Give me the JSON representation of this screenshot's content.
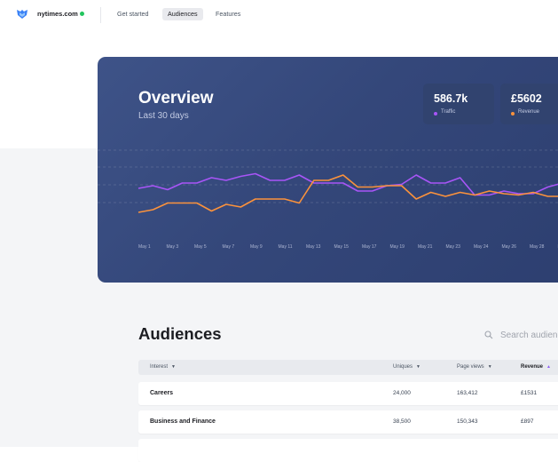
{
  "nav": {
    "site": "nytimes.com",
    "tabs": [
      "Get started",
      "Audiences",
      "Features"
    ],
    "active_tab": "Audiences"
  },
  "overview": {
    "title": "Overview",
    "subtitle": "Last 30 days",
    "stats": [
      {
        "value": "586.7k",
        "label": "Traffic",
        "color": "#a855f7"
      },
      {
        "value": "£5602",
        "label": "Revenue",
        "color": "#fb923c"
      }
    ]
  },
  "chart_data": {
    "type": "line",
    "x": [
      "May 1",
      "May 2",
      "May 3",
      "May 4",
      "May 5",
      "May 6",
      "May 7",
      "May 8",
      "May 9",
      "May 10",
      "May 11",
      "May 12",
      "May 13",
      "May 14",
      "May 15",
      "May 16",
      "May 17",
      "May 18",
      "May 19",
      "May 20",
      "May 21",
      "May 22",
      "May 23",
      "May 24",
      "May 25",
      "May 26",
      "May 27",
      "May 28",
      "May 29",
      "May 30"
    ],
    "tick_labels": [
      "May 1",
      "May 3",
      "May 5",
      "May 7",
      "May 9",
      "May 11",
      "May 13",
      "May 15",
      "May 17",
      "May 19",
      "May 21",
      "May 23",
      "May 24",
      "May 26",
      "May 28",
      "M"
    ],
    "series": [
      {
        "legend": "Traffic",
        "color": "#a855f7",
        "values": [
          38,
          40,
          37,
          42,
          42,
          46,
          44,
          47,
          49,
          44,
          44,
          48,
          42,
          42,
          42,
          36,
          36,
          40,
          41,
          48,
          42,
          42,
          46,
          33,
          33,
          36,
          34,
          34,
          39,
          42
        ]
      },
      {
        "legend": "Revenue",
        "color": "#fb923c",
        "values": [
          20,
          22,
          27,
          27,
          27,
          21,
          26,
          24,
          30,
          30,
          30,
          27,
          44,
          44,
          48,
          39,
          39,
          40,
          40,
          30,
          35,
          32,
          35,
          33,
          36,
          34,
          33,
          35,
          32,
          32
        ]
      }
    ],
    "ylim": [
      10,
      60
    ],
    "grid": true
  },
  "audiences": {
    "title": "Audiences",
    "search_placeholder": "Search audiences",
    "columns": [
      {
        "label": "Interest",
        "sort": "down",
        "sorted": false
      },
      {
        "label": "Uniques",
        "sort": "down",
        "sorted": false
      },
      {
        "label": "Page views",
        "sort": "down",
        "sorted": false
      },
      {
        "label": "Revenue",
        "sort": "up",
        "sorted": true
      }
    ],
    "rows": [
      [
        "Careers",
        "24,000",
        "163,412",
        "£1531"
      ],
      [
        "Business and Finance",
        "38,500",
        "150,343",
        "£897"
      ]
    ]
  }
}
